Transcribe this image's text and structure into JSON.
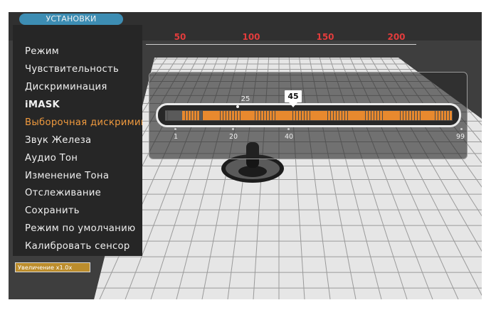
{
  "header": {
    "settings_tab": "УСТАНОВКИ"
  },
  "menu": {
    "items": [
      {
        "label": "Режим"
      },
      {
        "label": "Чувствительность"
      },
      {
        "label": "Дискриминация"
      },
      {
        "label": "iMASK"
      },
      {
        "label": "Выборочная дискримина"
      },
      {
        "label": "Звук Железа"
      },
      {
        "label": "Аудио Тон"
      },
      {
        "label": "Изменение Тона"
      },
      {
        "label": "Отслеживание"
      },
      {
        "label": "Сохранить"
      },
      {
        "label": "Режим по умолчанию"
      },
      {
        "label": "Калибровать сенсор"
      }
    ],
    "selected_index": 4
  },
  "depth_scale": {
    "labels": [
      "50",
      "100",
      "150",
      "200"
    ]
  },
  "slider": {
    "current_value": "45",
    "marker_label": "25",
    "tick_labels": [
      "1",
      "20",
      "40",
      "99"
    ],
    "min": 1,
    "max": 99,
    "accepted_segments": [
      [
        7,
        12
      ],
      [
        14,
        99
      ]
    ]
  },
  "status": {
    "zoom_label": "Увеличение x1.0x"
  },
  "colors": {
    "selected_menu": "#f09a3e",
    "segment_on": "#e8892e",
    "scale_labels": "#e23c3c",
    "tab": "#3d8db3",
    "badge": "#bc8d2c"
  }
}
